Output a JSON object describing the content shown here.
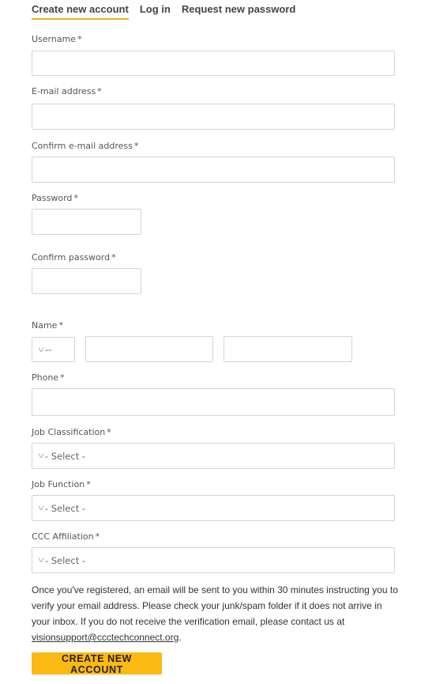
{
  "tabs": [
    {
      "label": "Create new account",
      "active": true
    },
    {
      "label": "Log in",
      "active": false
    },
    {
      "label": "Request new password",
      "active": false
    }
  ],
  "required_marker": "*",
  "fields": {
    "username": {
      "label": "Username",
      "value": ""
    },
    "email": {
      "label": "E-mail address",
      "value": ""
    },
    "confirm_email": {
      "label": "Confirm e-mail address",
      "value": ""
    },
    "password": {
      "label": "Password",
      "value": ""
    },
    "confirm_password": {
      "label": "Confirm password",
      "value": ""
    },
    "name": {
      "label": "Name",
      "prefix_selected": "--",
      "first": "",
      "last": ""
    },
    "phone": {
      "label": "Phone",
      "value": ""
    },
    "job_classification": {
      "label": "Job Classification",
      "selected": "- Select -"
    },
    "job_function": {
      "label": "Job Function",
      "selected": "- Select -"
    },
    "ccc_affiliation": {
      "label": "CCC Affiliation",
      "selected": "- Select -"
    }
  },
  "info": {
    "text": "Once you've registered, an email will be sent to you within 30 minutes instructing you to verify your email address. Please check your junk/spam folder if it does not arrive in your inbox. If you do not receive the verification email, please contact us at ",
    "email_link": "visionsupport@ccctechconnect.org",
    "suffix": "."
  },
  "submit_label": "CREATE NEW ACCOUNT",
  "colors": {
    "accent": "#fdb913",
    "tab_underline": "#e5b622"
  }
}
